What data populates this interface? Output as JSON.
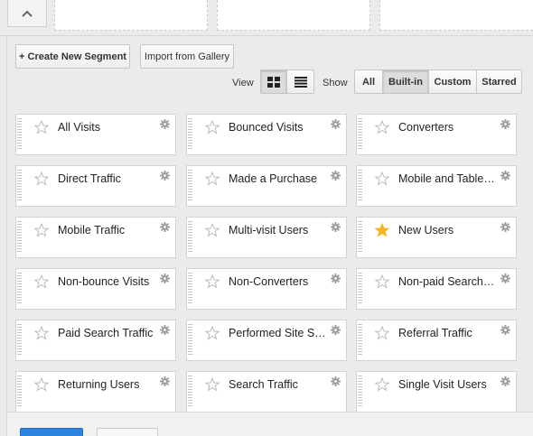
{
  "toolbar": {
    "create_label": "+ Create New Segment",
    "import_label": "Import from Gallery",
    "view_label": "View",
    "show_label": "Show",
    "view_modes": [
      {
        "name": "grid-view-icon",
        "active": true
      },
      {
        "name": "list-view-icon",
        "active": false
      }
    ],
    "filters": [
      {
        "label": "All",
        "active": false
      },
      {
        "label": "Built-in",
        "active": true
      },
      {
        "label": "Custom",
        "active": false
      },
      {
        "label": "Starred",
        "active": false
      }
    ]
  },
  "segments": [
    {
      "name": "All Visits",
      "starred": false
    },
    {
      "name": "Bounced Visits",
      "starred": false
    },
    {
      "name": "Converters",
      "starred": false
    },
    {
      "name": "Direct Traffic",
      "starred": false
    },
    {
      "name": "Made a Purchase",
      "starred": false
    },
    {
      "name": "Mobile and Table…",
      "starred": false
    },
    {
      "name": "Mobile Traffic",
      "starred": false
    },
    {
      "name": "Multi-visit Users",
      "starred": false
    },
    {
      "name": "New Users",
      "starred": true
    },
    {
      "name": "Non-bounce Visits",
      "starred": false
    },
    {
      "name": "Non-Converters",
      "starred": false
    },
    {
      "name": "Non-paid Search …",
      "starred": false
    },
    {
      "name": "Paid Search Traffic",
      "starred": false
    },
    {
      "name": "Performed Site S…",
      "starred": false
    },
    {
      "name": "Referral Traffic",
      "starred": false
    },
    {
      "name": "Returning Users",
      "starred": false
    },
    {
      "name": "Search Traffic",
      "starred": false
    },
    {
      "name": "Single Visit Users",
      "starred": false
    }
  ],
  "colors": {
    "star_active": "#f5b41e",
    "star_inactive": "#bbbbbb",
    "primary_button": "#2b84e0"
  }
}
